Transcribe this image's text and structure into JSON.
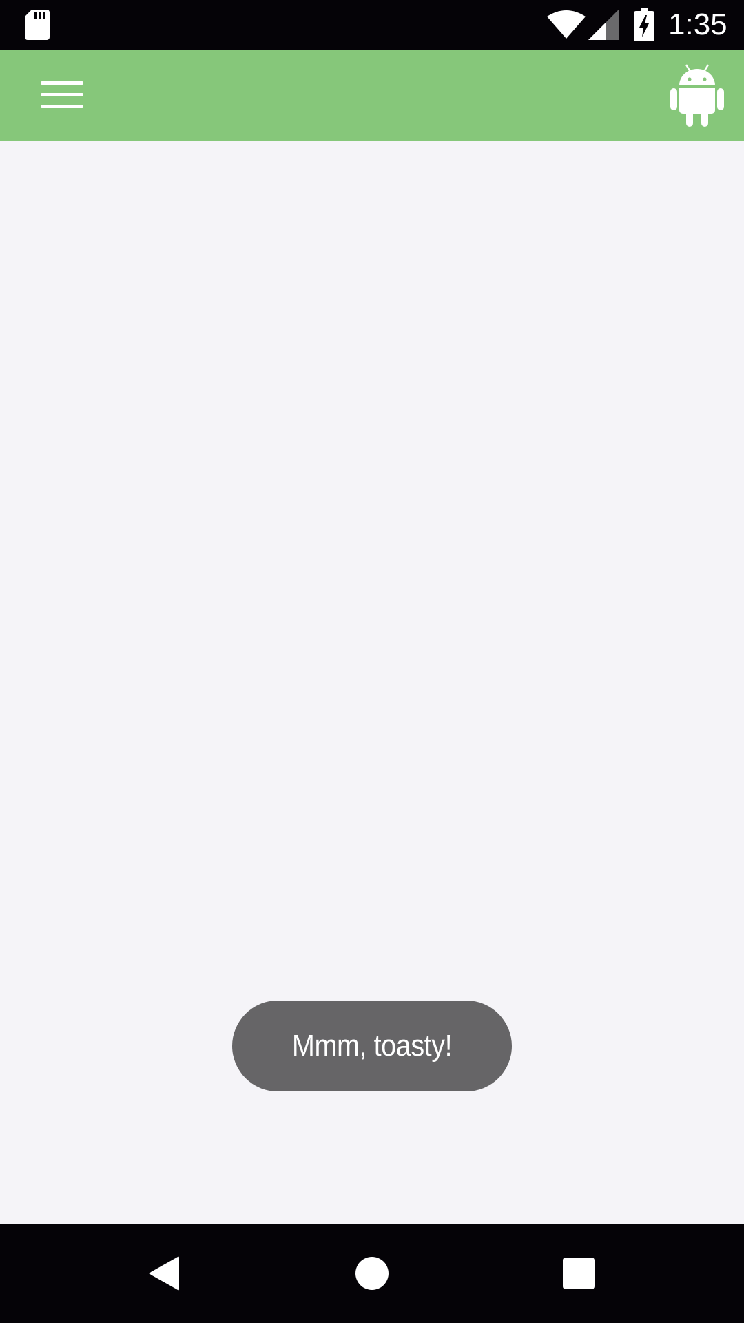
{
  "status_bar": {
    "time": "1:35",
    "icons": [
      "sd-card-icon",
      "wifi-icon",
      "cellular-signal-icon",
      "battery-charging-icon"
    ]
  },
  "app_bar": {
    "color": "#86c77a",
    "menu_icon": "hamburger-menu-icon",
    "action_icon": "android-robot-icon"
  },
  "toast": {
    "message": "Mmm, toasty!",
    "background": "#666567"
  },
  "nav_bar": {
    "buttons": [
      "back-icon",
      "home-icon",
      "recents-icon"
    ]
  },
  "colors": {
    "status_bar": "#050307",
    "content_background": "#f5f4f8",
    "nav_bar": "#050307"
  }
}
